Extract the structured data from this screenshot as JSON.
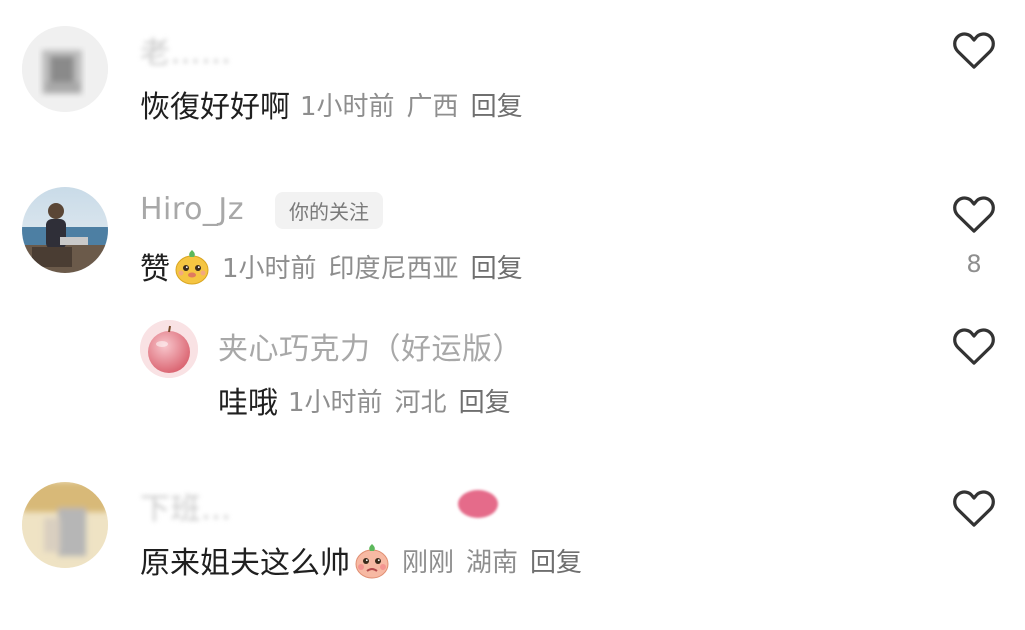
{
  "comments": [
    {
      "name": "老……",
      "text": "恢復好好啊",
      "time": "1小时前",
      "location": "广西",
      "reply": "回复",
      "avatar": "blurred-avatar"
    },
    {
      "name": "Hiro_Jz",
      "badge": "你的关注",
      "text": "赞",
      "emoji": "smiling-face-emoji",
      "time": "1小时前",
      "location": "印度尼西亚",
      "reply": "回复",
      "like_count": "8",
      "avatar": "fisherman-avatar"
    },
    {
      "name": "夹心巧克力（好运版）",
      "text": "哇哦",
      "time": "1小时前",
      "location": "河北",
      "reply": "回复",
      "avatar": "apple-avatar",
      "is_reply": true
    },
    {
      "name": "下班…",
      "text": "原来姐夫这么帅",
      "emoji": "shy-face-emoji",
      "time": "刚刚",
      "location": "湖南",
      "reply": "回复",
      "avatar": "blurred-avatar-2"
    }
  ],
  "icons": {
    "like": "heart-outline-icon"
  },
  "colors": {
    "name": "#a8a8a8",
    "text": "#1f1f1f",
    "meta": "#8e8e8e",
    "icon": "#333333"
  }
}
